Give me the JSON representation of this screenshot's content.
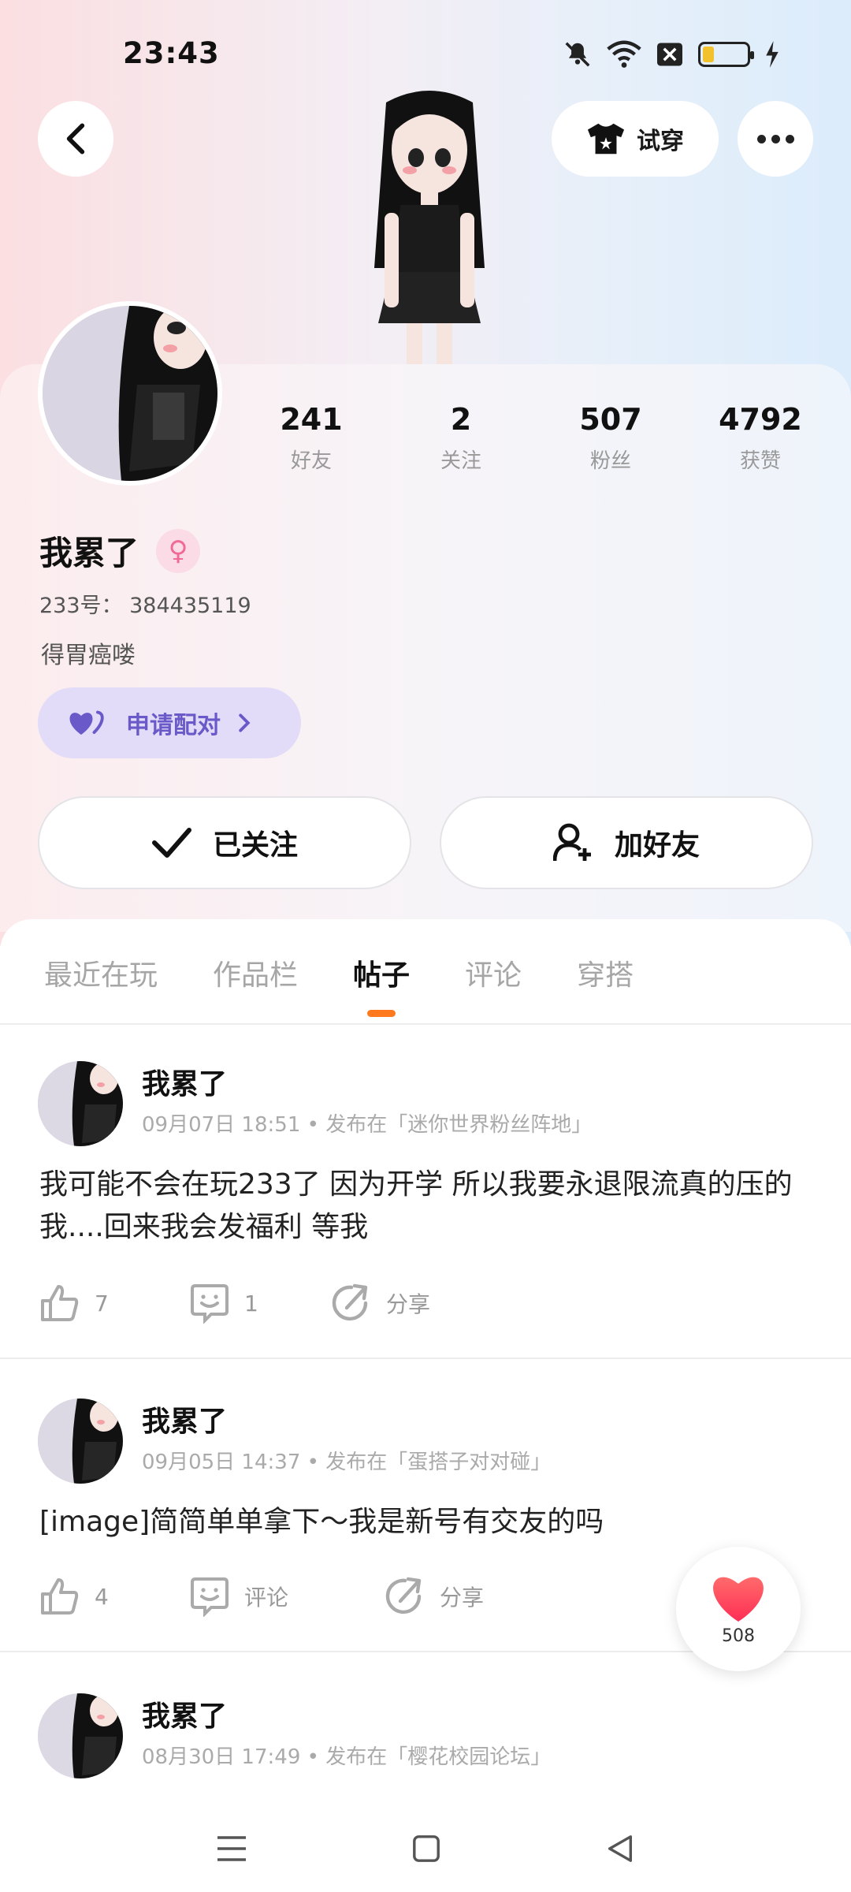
{
  "status_bar": {
    "time": "23:43",
    "icons": [
      "mute-icon",
      "wifi-icon",
      "x-box-icon",
      "battery-icon",
      "charging-icon"
    ]
  },
  "header": {
    "try_on_label": "试穿"
  },
  "profile": {
    "stats": [
      {
        "value": "241",
        "label": "好友"
      },
      {
        "value": "2",
        "label": "关注"
      },
      {
        "value": "507",
        "label": "粉丝"
      },
      {
        "value": "4792",
        "label": "获赞"
      }
    ],
    "username": "我累了",
    "gender_symbol": "♀",
    "uid": "233号： 384435119",
    "bio": "得胃癌喽",
    "pair_label": "申请配对",
    "followed_label": "已关注",
    "add_friend_label": "加好友"
  },
  "tabs": [
    "最近在玩",
    "作品栏",
    "帖子",
    "评论",
    "穿搭"
  ],
  "active_tab": "帖子",
  "posts": [
    {
      "author": "我累了",
      "meta": "09月07日 18:51 • 发布在「迷你世界粉丝阵地」",
      "text": "我可能不会在玩233了 因为开学 所以我要永退限流真的压的我....回来我会发福利 等我",
      "likes": "7",
      "comments": "1",
      "share_label": "分享"
    },
    {
      "author": "我累了",
      "meta": "09月05日 14:37 • 发布在「蛋搭子对对碰」",
      "text": "[image]简简单单拿下～我是新号有交友的吗",
      "likes": "4",
      "comments": "评论",
      "share_label": "分享"
    },
    {
      "author": "我累了",
      "meta": "08月30日 17:49 • 发布在「樱花校园论坛」"
    }
  ],
  "floating_like": {
    "count": "508"
  },
  "colors": {
    "accent": "#ff7a1f",
    "pair_bg": "#e2dcf8",
    "pair_text": "#6a5ac9",
    "heart": "#ff3355"
  }
}
